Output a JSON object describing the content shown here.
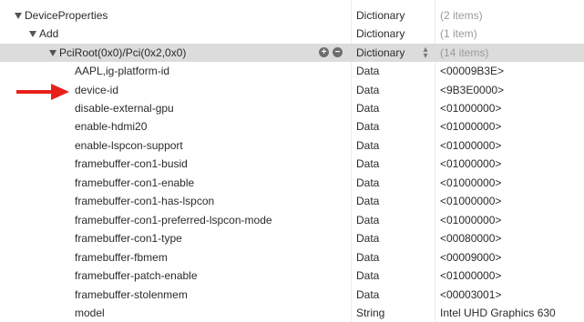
{
  "rows": [
    {
      "key": "DeviceProperties",
      "type": "Dictionary",
      "value": "(2 items)"
    },
    {
      "key": "Add",
      "type": "Dictionary",
      "value": "(1 item)"
    },
    {
      "key": "PciRoot(0x0)/Pci(0x2,0x0)",
      "type": "Dictionary",
      "value": "(14 items)"
    },
    {
      "key": "AAPL,ig-platform-id",
      "type": "Data",
      "value": "<00009B3E>"
    },
    {
      "key": "device-id",
      "type": "Data",
      "value": "<9B3E0000>"
    },
    {
      "key": "disable-external-gpu",
      "type": "Data",
      "value": "<01000000>"
    },
    {
      "key": "enable-hdmi20",
      "type": "Data",
      "value": "<01000000>"
    },
    {
      "key": "enable-lspcon-support",
      "type": "Data",
      "value": "<01000000>"
    },
    {
      "key": "framebuffer-con1-busid",
      "type": "Data",
      "value": "<01000000>"
    },
    {
      "key": "framebuffer-con1-enable",
      "type": "Data",
      "value": "<01000000>"
    },
    {
      "key": "framebuffer-con1-has-lspcon",
      "type": "Data",
      "value": "<01000000>"
    },
    {
      "key": "framebuffer-con1-preferred-lspcon-mode",
      "type": "Data",
      "value": "<01000000>"
    },
    {
      "key": "framebuffer-con1-type",
      "type": "Data",
      "value": "<00080000>"
    },
    {
      "key": "framebuffer-fbmem",
      "type": "Data",
      "value": "<00009000>"
    },
    {
      "key": "framebuffer-patch-enable",
      "type": "Data",
      "value": "<01000000>"
    },
    {
      "key": "framebuffer-stolenmem",
      "type": "Data",
      "value": "<00003001>"
    },
    {
      "key": "model",
      "type": "String",
      "value": "Intel UHD Graphics 630"
    }
  ],
  "colors": {
    "selected_row": "#dcdcdc",
    "arrow": "#e8201a",
    "muted_value": "#9a9a9a"
  },
  "icons": {
    "disclosure": "disclosure-triangle-icon",
    "add": "add-circle-icon",
    "remove": "remove-circle-icon",
    "type_popup": "up-down-chevron-icon",
    "annotation": "red-arrow-icon"
  }
}
